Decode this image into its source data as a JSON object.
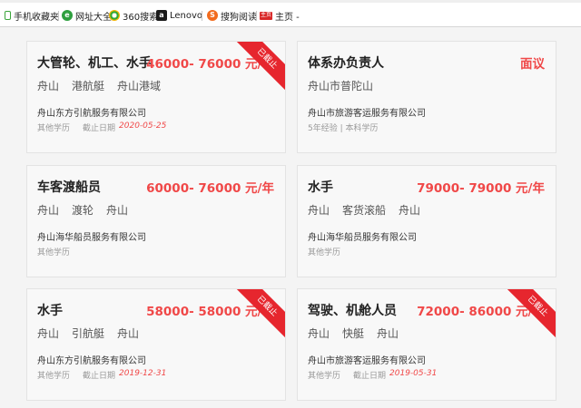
{
  "bookmarks": [
    {
      "label": "手机收藏夹",
      "icon": "phone-icon"
    },
    {
      "label": "网址大全",
      "icon": "navigation-icon",
      "glyph": "e"
    },
    {
      "label": "360搜索",
      "icon": "360-search-icon",
      "glyph": ""
    },
    {
      "label": "Lenovo",
      "icon": "lenovo-icon",
      "glyph": "a"
    },
    {
      "label": "搜狗阅读",
      "icon": "sogou-icon",
      "glyph": "S"
    },
    {
      "label": "主页 -",
      "icon": "home-icon",
      "glyph": "主页"
    }
  ],
  "jobs": [
    {
      "title": "大管轮、机工、水手",
      "salary": "46000- 76000 元/年",
      "tags": [
        "舟山",
        "港航艇",
        "舟山港域"
      ],
      "company": "舟山东方引航服务有限公司",
      "education": "其他学历",
      "deadline_label": "截止日期",
      "deadline": "2020-05-25",
      "ribbon": "已截止"
    },
    {
      "title": "体系办负责人",
      "salary": "面议",
      "tags": [
        "舟山市普陀山"
      ],
      "company": "舟山市旅游客运服务有限公司",
      "requirements": "5年经验 | 本科学历"
    },
    {
      "title": "车客渡船员",
      "salary": "60000- 76000 元/年",
      "tags": [
        "舟山",
        "渡轮",
        "舟山"
      ],
      "company": "舟山海华船员服务有限公司",
      "education": "其他学历"
    },
    {
      "title": "水手",
      "salary": "79000- 79000 元/年",
      "tags": [
        "舟山",
        "客货滚船",
        "舟山"
      ],
      "company": "舟山海华船员服务有限公司",
      "education": "其他学历"
    },
    {
      "title": "水手",
      "salary": "58000- 58000 元/年",
      "tags": [
        "舟山",
        "引航艇",
        "舟山"
      ],
      "company": "舟山东方引航服务有限公司",
      "education": "其他学历",
      "deadline_label": "截止日期",
      "deadline": "2019-12-31",
      "ribbon": "已截止"
    },
    {
      "title": "驾驶、机舱人员",
      "salary": "72000- 86000 元/年",
      "tags": [
        "舟山",
        "快艇",
        "舟山"
      ],
      "company": "舟山市旅游客运服务有限公司",
      "education": "其他学历",
      "deadline_label": "截止日期",
      "deadline": "2019-05-31",
      "ribbon": "已截止"
    }
  ],
  "colors": {
    "accent": "#f04848",
    "ribbon": "#e6262e"
  }
}
